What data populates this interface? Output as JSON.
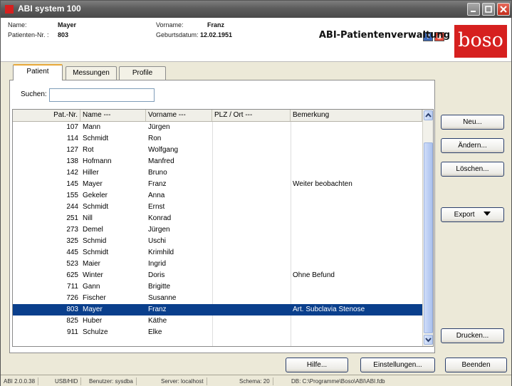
{
  "window": {
    "title": "ABI system 100"
  },
  "patient_info": {
    "name_label": "Name:",
    "name_value": "Mayer",
    "id_label": "Patienten-Nr. :",
    "id_value": "803",
    "firstname_label": "Vorname:",
    "firstname_value": "Franz",
    "birthdate_label": "Geburtsdatum:",
    "birthdate_value": "12.02.1951"
  },
  "header": {
    "app_title": "ABI-Patientenverwaltung",
    "brand": "boso",
    "help_icon": "?",
    "info_icon": "◉"
  },
  "tabs": [
    "Patient",
    "Messungen",
    "Profile"
  ],
  "search": {
    "label": "Suchen:",
    "value": ""
  },
  "table": {
    "columns": [
      "Pat.-Nr.",
      "Name ---",
      "Vorname ---",
      "PLZ / Ort ---",
      "Bemerkung"
    ],
    "rows": [
      {
        "nr": "107",
        "name": "Mann",
        "vorname": "Jürgen",
        "ort": "",
        "bemerkung": ""
      },
      {
        "nr": "114",
        "name": "Schmidt",
        "vorname": "Ron",
        "ort": "",
        "bemerkung": ""
      },
      {
        "nr": "127",
        "name": "Rot",
        "vorname": "Wolfgang",
        "ort": "",
        "bemerkung": ""
      },
      {
        "nr": "138",
        "name": "Hofmann",
        "vorname": "Manfred",
        "ort": "",
        "bemerkung": ""
      },
      {
        "nr": "142",
        "name": "Hiller",
        "vorname": "Bruno",
        "ort": "",
        "bemerkung": ""
      },
      {
        "nr": "145",
        "name": "Mayer",
        "vorname": "Franz",
        "ort": "",
        "bemerkung": "Weiter beobachten"
      },
      {
        "nr": "155",
        "name": "Gekeler",
        "vorname": "Anna",
        "ort": "",
        "bemerkung": ""
      },
      {
        "nr": "244",
        "name": "Schmidt",
        "vorname": "Ernst",
        "ort": "",
        "bemerkung": ""
      },
      {
        "nr": "251",
        "name": "Nill",
        "vorname": "Konrad",
        "ort": "",
        "bemerkung": ""
      },
      {
        "nr": "273",
        "name": "Demel",
        "vorname": "Jürgen",
        "ort": "",
        "bemerkung": ""
      },
      {
        "nr": "325",
        "name": "Schmid",
        "vorname": "Uschi",
        "ort": "",
        "bemerkung": ""
      },
      {
        "nr": "445",
        "name": "Schmidt",
        "vorname": "Krimhild",
        "ort": "",
        "bemerkung": ""
      },
      {
        "nr": "523",
        "name": "Maier",
        "vorname": "Ingrid",
        "ort": "",
        "bemerkung": ""
      },
      {
        "nr": "625",
        "name": "Winter",
        "vorname": "Doris",
        "ort": "",
        "bemerkung": "Ohne Befund"
      },
      {
        "nr": "711",
        "name": "Gann",
        "vorname": "Brigitte",
        "ort": "",
        "bemerkung": ""
      },
      {
        "nr": "726",
        "name": "Fischer",
        "vorname": "Susanne",
        "ort": "",
        "bemerkung": ""
      },
      {
        "nr": "803",
        "name": "Mayer",
        "vorname": "Franz",
        "ort": "",
        "bemerkung": "Art. Subclavia Stenose",
        "selected": true
      },
      {
        "nr": "825",
        "name": "Huber",
        "vorname": "Käthe",
        "ort": "",
        "bemerkung": ""
      },
      {
        "nr": "911",
        "name": "Schulze",
        "vorname": "Elke",
        "ort": "",
        "bemerkung": ""
      }
    ]
  },
  "side_buttons": {
    "new": "Neu...",
    "edit": "Ändern...",
    "delete": "Löschen...",
    "export": "Export",
    "print": "Drucken..."
  },
  "bottom_buttons": {
    "help": "Hilfe...",
    "settings": "Einstellungen...",
    "quit": "Beenden"
  },
  "statusbar": {
    "version": "ABI 2.0.0.38",
    "interface": "USB/HID",
    "user": "Benutzer: sysdba",
    "server": "Server: localhost",
    "schema": "Schema: 20",
    "db": "DB: C:\\Programme\\Boso\\ABI\\ABI.fdb"
  },
  "colors": {
    "selection": "#0a3f8c",
    "brand_red": "#d6201f",
    "tab_accent": "#e8a83a"
  }
}
